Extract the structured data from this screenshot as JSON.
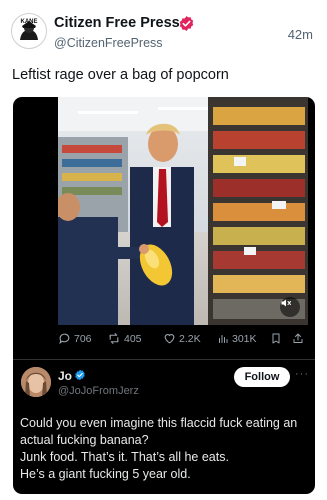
{
  "post": {
    "author_name": "Citizen Free Press",
    "author_handle": "@CitizenFreePress",
    "time": "42m",
    "text": "Leftist rage over a bag of popcorn",
    "avatar_text": "KANE"
  },
  "embed": {
    "stats": {
      "replies": "706",
      "reposts": "405",
      "likes": "2.2K",
      "views": "301K"
    },
    "quote": {
      "author_name": "Jo",
      "author_handle": "@JoJoFromJerz",
      "follow_label": "Follow",
      "more_label": "···",
      "text_lines": [
        "Could you even imagine this flaccid fuck eating an",
        "actual fucking banana?",
        "Junk food. That’s it. That’s all he eats.",
        "He’s a giant fucking 5 year old."
      ]
    }
  },
  "colors": {
    "verified_blue": "#1d9bf0",
    "embed_background": "#000000",
    "follow_button": "#ffffff"
  },
  "icons": [
    "verified-badge-icon",
    "reply-icon",
    "repost-icon",
    "like-icon",
    "views-icon",
    "bookmark-icon",
    "share-icon",
    "speaker-muted-icon"
  ]
}
